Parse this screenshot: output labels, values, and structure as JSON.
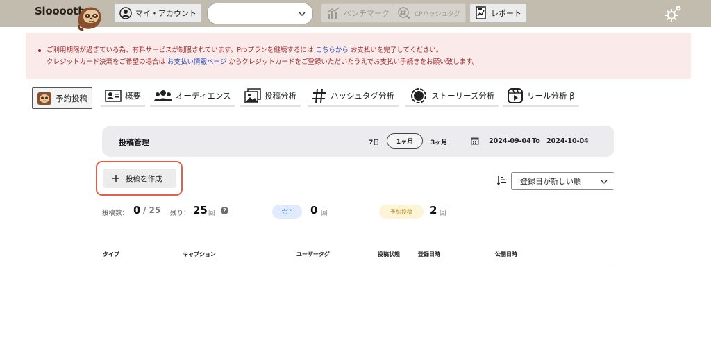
{
  "app": {
    "logo_text": "Slooooth",
    "colors": {
      "topbar": "#c1bcae",
      "alert_bg": "#fbeaea",
      "alert_text": "#9c2a2a",
      "link": "#3056c4",
      "highlight": "#e2604a"
    }
  },
  "topbar": {
    "account_label": "マイ・アカウント",
    "benchmark_label": "ベンチマーク",
    "cp_hashtag_label": "CPハッシュタグ",
    "report_label": "レポート",
    "account_select_value": ""
  },
  "alert": {
    "line1_pre": "ご利用期限が過ぎている為、有料サービスが制限されています。Proプランを継続するには",
    "line1_link": "こちらから",
    "line1_post": "お支払いを完了してください。",
    "line2_pre": "クレジットカード決済をご希望の場合は",
    "line2_link": "お支払い情報ページ",
    "line2_post": "からクレジットカードをご登録いただいたうえでお支払い手続きをお願い致します。"
  },
  "nav": [
    {
      "label": "予約投稿",
      "icon": "sloth-icon"
    },
    {
      "label": "概要",
      "icon": "id-card-icon"
    },
    {
      "label": "オーディエンス",
      "icon": "users-icon"
    },
    {
      "label": "投稿分析",
      "icon": "image-icon"
    },
    {
      "label": "ハッシュタグ分析",
      "icon": "hashtag-icon"
    },
    {
      "label": "ストーリーズ分析",
      "icon": "stories-icon"
    },
    {
      "label": "リール分析 β",
      "icon": "reels-icon"
    }
  ],
  "content": {
    "title": "投稿管理",
    "ranges": [
      "7日",
      "1ヶ月",
      "3ヶ月"
    ],
    "selected_range": "1ヶ月",
    "date_from": "2024-09-04",
    "date_to_label": "To",
    "date_to": "2024-10-04",
    "create_label": "投稿を作成",
    "sort_value": "登録日が新しい順"
  },
  "stats": {
    "posts_label": "投稿数：",
    "posts_count": "0",
    "posts_total": "/ 25",
    "remaining_label": "残り：",
    "remaining_count": "25",
    "remaining_unit": "回",
    "done_badge": "完了",
    "done_count": "0",
    "done_unit": "回",
    "scheduled_badge": "予約投稿",
    "scheduled_count": "2",
    "scheduled_unit": "回"
  },
  "table": {
    "columns": [
      "タイプ",
      "キャプション",
      "ユーザータグ",
      "投稿状態",
      "登録日時",
      "公開日時"
    ]
  }
}
